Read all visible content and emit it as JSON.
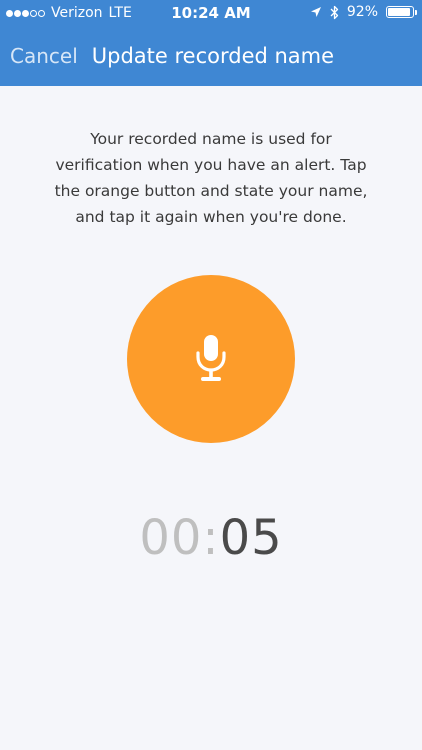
{
  "status_bar": {
    "carrier": "Verizon",
    "network": "LTE",
    "time": "10:24 AM",
    "battery": "92%",
    "battery_level": 0.92,
    "signal_bars_filled": 3,
    "signal_bars_total": 5
  },
  "nav": {
    "cancel_label": "Cancel",
    "title": "Update recorded name"
  },
  "main": {
    "instructions": "Your recorded name is used for verification when you have an alert. Tap the orange button and state your name, and tap it again when you're done.",
    "record_button_icon": "microphone-icon",
    "timer": {
      "minutes": "00",
      "separator": ":",
      "seconds": "05"
    }
  },
  "colors": {
    "header": "#3f87d3",
    "accent": "#fd9c2a",
    "background": "#f5f6fa"
  }
}
